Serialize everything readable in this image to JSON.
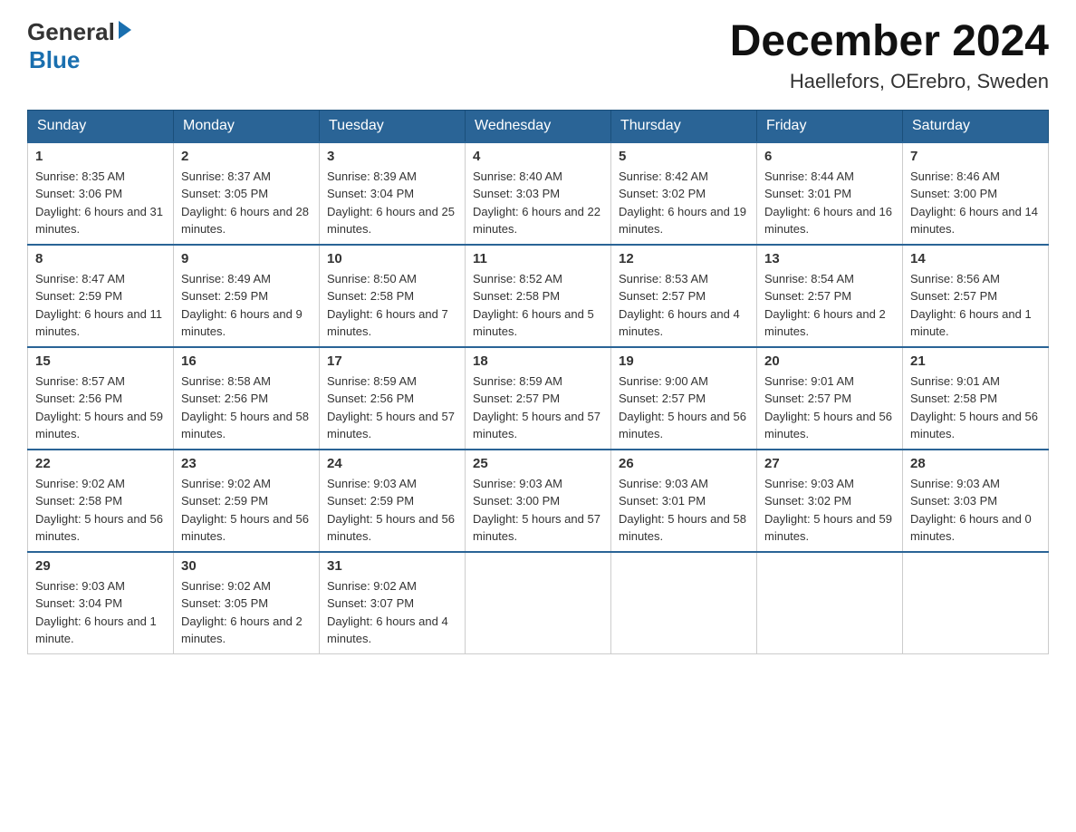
{
  "header": {
    "logo_general": "General",
    "logo_arrow": "▶",
    "logo_blue": "Blue",
    "month_title": "December 2024",
    "location": "Haellefors, OErebro, Sweden"
  },
  "days_of_week": [
    "Sunday",
    "Monday",
    "Tuesday",
    "Wednesday",
    "Thursday",
    "Friday",
    "Saturday"
  ],
  "weeks": [
    [
      {
        "day": "1",
        "sunrise": "8:35 AM",
        "sunset": "3:06 PM",
        "daylight": "6 hours and 31 minutes."
      },
      {
        "day": "2",
        "sunrise": "8:37 AM",
        "sunset": "3:05 PM",
        "daylight": "6 hours and 28 minutes."
      },
      {
        "day": "3",
        "sunrise": "8:39 AM",
        "sunset": "3:04 PM",
        "daylight": "6 hours and 25 minutes."
      },
      {
        "day": "4",
        "sunrise": "8:40 AM",
        "sunset": "3:03 PM",
        "daylight": "6 hours and 22 minutes."
      },
      {
        "day": "5",
        "sunrise": "8:42 AM",
        "sunset": "3:02 PM",
        "daylight": "6 hours and 19 minutes."
      },
      {
        "day": "6",
        "sunrise": "8:44 AM",
        "sunset": "3:01 PM",
        "daylight": "6 hours and 16 minutes."
      },
      {
        "day": "7",
        "sunrise": "8:46 AM",
        "sunset": "3:00 PM",
        "daylight": "6 hours and 14 minutes."
      }
    ],
    [
      {
        "day": "8",
        "sunrise": "8:47 AM",
        "sunset": "2:59 PM",
        "daylight": "6 hours and 11 minutes."
      },
      {
        "day": "9",
        "sunrise": "8:49 AM",
        "sunset": "2:59 PM",
        "daylight": "6 hours and 9 minutes."
      },
      {
        "day": "10",
        "sunrise": "8:50 AM",
        "sunset": "2:58 PM",
        "daylight": "6 hours and 7 minutes."
      },
      {
        "day": "11",
        "sunrise": "8:52 AM",
        "sunset": "2:58 PM",
        "daylight": "6 hours and 5 minutes."
      },
      {
        "day": "12",
        "sunrise": "8:53 AM",
        "sunset": "2:57 PM",
        "daylight": "6 hours and 4 minutes."
      },
      {
        "day": "13",
        "sunrise": "8:54 AM",
        "sunset": "2:57 PM",
        "daylight": "6 hours and 2 minutes."
      },
      {
        "day": "14",
        "sunrise": "8:56 AM",
        "sunset": "2:57 PM",
        "daylight": "6 hours and 1 minute."
      }
    ],
    [
      {
        "day": "15",
        "sunrise": "8:57 AM",
        "sunset": "2:56 PM",
        "daylight": "5 hours and 59 minutes."
      },
      {
        "day": "16",
        "sunrise": "8:58 AM",
        "sunset": "2:56 PM",
        "daylight": "5 hours and 58 minutes."
      },
      {
        "day": "17",
        "sunrise": "8:59 AM",
        "sunset": "2:56 PM",
        "daylight": "5 hours and 57 minutes."
      },
      {
        "day": "18",
        "sunrise": "8:59 AM",
        "sunset": "2:57 PM",
        "daylight": "5 hours and 57 minutes."
      },
      {
        "day": "19",
        "sunrise": "9:00 AM",
        "sunset": "2:57 PM",
        "daylight": "5 hours and 56 minutes."
      },
      {
        "day": "20",
        "sunrise": "9:01 AM",
        "sunset": "2:57 PM",
        "daylight": "5 hours and 56 minutes."
      },
      {
        "day": "21",
        "sunrise": "9:01 AM",
        "sunset": "2:58 PM",
        "daylight": "5 hours and 56 minutes."
      }
    ],
    [
      {
        "day": "22",
        "sunrise": "9:02 AM",
        "sunset": "2:58 PM",
        "daylight": "5 hours and 56 minutes."
      },
      {
        "day": "23",
        "sunrise": "9:02 AM",
        "sunset": "2:59 PM",
        "daylight": "5 hours and 56 minutes."
      },
      {
        "day": "24",
        "sunrise": "9:03 AM",
        "sunset": "2:59 PM",
        "daylight": "5 hours and 56 minutes."
      },
      {
        "day": "25",
        "sunrise": "9:03 AM",
        "sunset": "3:00 PM",
        "daylight": "5 hours and 57 minutes."
      },
      {
        "day": "26",
        "sunrise": "9:03 AM",
        "sunset": "3:01 PM",
        "daylight": "5 hours and 58 minutes."
      },
      {
        "day": "27",
        "sunrise": "9:03 AM",
        "sunset": "3:02 PM",
        "daylight": "5 hours and 59 minutes."
      },
      {
        "day": "28",
        "sunrise": "9:03 AM",
        "sunset": "3:03 PM",
        "daylight": "6 hours and 0 minutes."
      }
    ],
    [
      {
        "day": "29",
        "sunrise": "9:03 AM",
        "sunset": "3:04 PM",
        "daylight": "6 hours and 1 minute."
      },
      {
        "day": "30",
        "sunrise": "9:02 AM",
        "sunset": "3:05 PM",
        "daylight": "6 hours and 2 minutes."
      },
      {
        "day": "31",
        "sunrise": "9:02 AM",
        "sunset": "3:07 PM",
        "daylight": "6 hours and 4 minutes."
      },
      null,
      null,
      null,
      null
    ]
  ],
  "labels": {
    "sunrise": "Sunrise:",
    "sunset": "Sunset:",
    "daylight": "Daylight:"
  }
}
